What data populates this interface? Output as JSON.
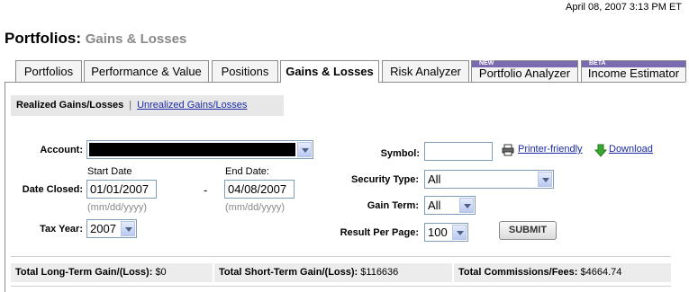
{
  "header": {
    "timestamp": "April 08, 2007 3:13 PM ET",
    "title": "Portfolios:",
    "subtitle": "Gains & Losses"
  },
  "tabs": [
    {
      "label": "Portfolios",
      "active": false
    },
    {
      "label": "Performance & Value",
      "active": false
    },
    {
      "label": "Positions",
      "active": false
    },
    {
      "label": "Gains & Losses",
      "active": true
    },
    {
      "label": "Risk Analyzer",
      "active": false
    },
    {
      "label": "Portfolio Analyzer",
      "active": false,
      "badge": "NEW"
    },
    {
      "label": "Income Estimator",
      "active": false,
      "badge": "BETA"
    }
  ],
  "subnav": {
    "current": "Realized Gains/Losses",
    "separator": "|",
    "other": "Unrealized Gains/Losses"
  },
  "form": {
    "account_label": "Account:",
    "date_closed_label": "Date Closed:",
    "start_date_label": "Start Date",
    "end_date_label": "End Date:",
    "start_date": "01/01/2007",
    "end_date": "04/08/2007",
    "date_hint": "(mm/dd/yyyy)",
    "dash": "-",
    "tax_year_label": "Tax Year:",
    "tax_year": "2007",
    "symbol_label": "Symbol:",
    "symbol_value": "",
    "security_type_label": "Security Type:",
    "security_type": "All",
    "gain_term_label": "Gain Term:",
    "gain_term": "All",
    "result_per_page_label": "Result Per Page:",
    "result_per_page": "100",
    "submit_label": "SUBMIT",
    "printer_friendly": "Printer-friendly",
    "download": "Download"
  },
  "totals": {
    "long_term_label": "Total Long-Term Gain/(Loss):",
    "long_term_value": "$0",
    "short_term_label": "Total Short-Term Gain/(Loss):",
    "short_term_value": "$116636",
    "commissions_label": "Total Commissions/Fees:",
    "commissions_value": "$4664.74"
  },
  "colors": {
    "link": "#1a2aa5",
    "badge": "#7a6ab0",
    "download_arrow": "#3aa632"
  },
  "icons": {
    "printer": "printer-icon",
    "download": "download-arrow-icon",
    "dropdown": "chevron-down-icon"
  }
}
